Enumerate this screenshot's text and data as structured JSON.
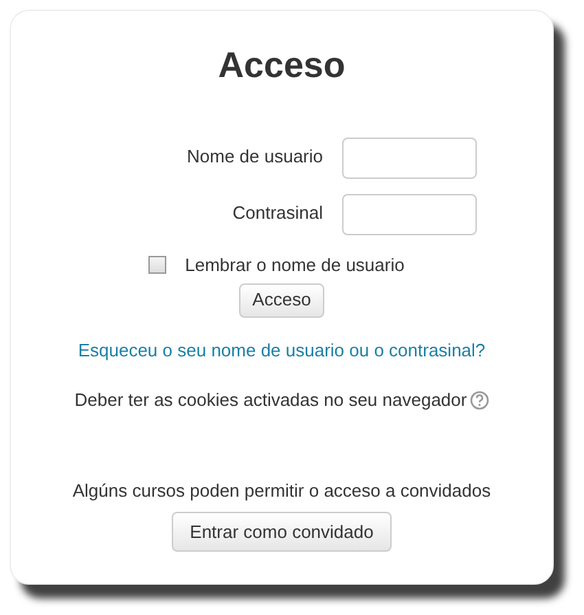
{
  "title": "Acceso",
  "fields": [
    {
      "label": "Nome de usuario"
    },
    {
      "label": "Contrasinal"
    }
  ],
  "remember": {
    "label": "Lembrar o nome de usuario",
    "checked": false
  },
  "login_button": "Acceso",
  "forgot_link": "Esqueceu o seu nome de usuario ou o contrasinal?",
  "cookies_note": "Deber ter as cookies activadas no seu navegador",
  "guest_note": "Algúns cursos poden permitir o acceso a convidados",
  "guest_button": "Entrar como convidado"
}
